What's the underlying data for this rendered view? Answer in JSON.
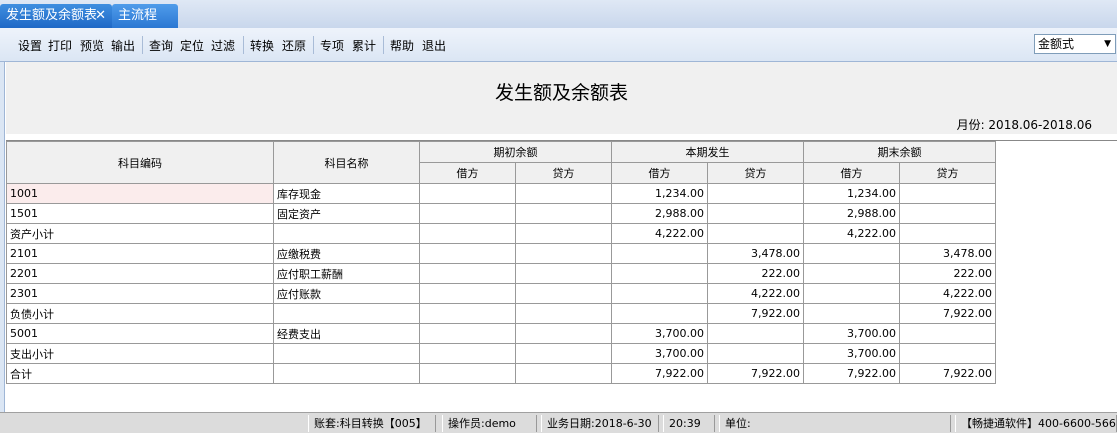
{
  "tabs": [
    {
      "label": "发生额及余额表"
    },
    {
      "label": "主流程"
    }
  ],
  "tab_close": "✕",
  "toolbar": {
    "items": [
      "设置",
      "打印",
      "预览",
      "输出",
      "查询",
      "定位",
      "过滤",
      "转换",
      "还原",
      "专项",
      "累计",
      "帮助",
      "退出"
    ],
    "format_select": "金额式"
  },
  "report": {
    "title": "发生额及余额表",
    "period": "月份: 2018.06-2018.06"
  },
  "table": {
    "headers": {
      "code": "科目编码",
      "name": "科目名称",
      "opening": "期初余额",
      "current": "本期发生",
      "closing": "期末余额",
      "debit": "借方",
      "credit": "贷方"
    },
    "rows": [
      {
        "code": "1001",
        "name": "库存现金",
        "od": "",
        "oc": "",
        "cd": "1,234.00",
        "cc": "",
        "ed": "1,234.00",
        "ec": ""
      },
      {
        "code": "1501",
        "name": "固定资产",
        "od": "",
        "oc": "",
        "cd": "2,988.00",
        "cc": "",
        "ed": "2,988.00",
        "ec": ""
      },
      {
        "code": "资产小计",
        "name": "",
        "od": "",
        "oc": "",
        "cd": "4,222.00",
        "cc": "",
        "ed": "4,222.00",
        "ec": ""
      },
      {
        "code": "2101",
        "name": "应缴税费",
        "od": "",
        "oc": "",
        "cd": "",
        "cc": "3,478.00",
        "ed": "",
        "ec": "3,478.00"
      },
      {
        "code": "2201",
        "name": "应付职工薪酬",
        "od": "",
        "oc": "",
        "cd": "",
        "cc": "222.00",
        "ed": "",
        "ec": "222.00"
      },
      {
        "code": "2301",
        "name": "应付账款",
        "od": "",
        "oc": "",
        "cd": "",
        "cc": "4,222.00",
        "ed": "",
        "ec": "4,222.00"
      },
      {
        "code": "负债小计",
        "name": "",
        "od": "",
        "oc": "",
        "cd": "",
        "cc": "7,922.00",
        "ed": "",
        "ec": "7,922.00"
      },
      {
        "code": "5001",
        "name": "经费支出",
        "od": "",
        "oc": "",
        "cd": "3,700.00",
        "cc": "",
        "ed": "3,700.00",
        "ec": ""
      },
      {
        "code": "支出小计",
        "name": "",
        "od": "",
        "oc": "",
        "cd": "3,700.00",
        "cc": "",
        "ed": "3,700.00",
        "ec": ""
      },
      {
        "code": "合计",
        "name": "",
        "od": "",
        "oc": "",
        "cd": "7,922.00",
        "cc": "7,922.00",
        "ed": "7,922.00",
        "ec": "7,922.00"
      }
    ]
  },
  "status": {
    "account": "账套:科目转换【005】",
    "operator": "操作员:demo",
    "date": "业务日期:2018-6-30",
    "time": "20:39",
    "unit": "单位:",
    "company": "【畅捷通软件】400-6600-566"
  }
}
